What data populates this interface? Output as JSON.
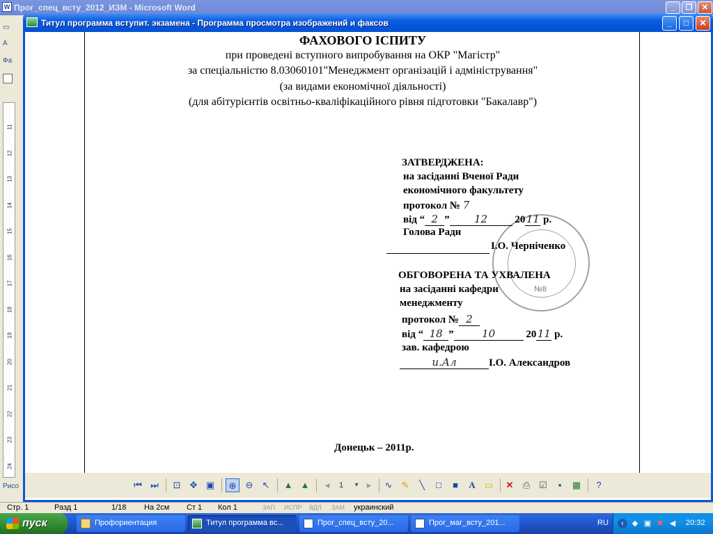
{
  "word_window": {
    "title": "Прог_спец_всту_2012_ИЗМ - Microsoft Word",
    "minimize_label": "_",
    "maximize_label": "❐",
    "close_label": "✕",
    "toolbar_fragment_1": "A",
    "toolbar_fragment_2": "Фа",
    "toolbar_fragment_3": "Рисо",
    "ruler_numbers": [
      "11",
      "12",
      "13",
      "14",
      "15",
      "16",
      "17",
      "18",
      "19",
      "20",
      "21",
      "22",
      "23",
      "24"
    ]
  },
  "viewer_window": {
    "title": "Титул программа вступит. экзамена - Программа просмотра изображений и факсов",
    "minimize_label": "_",
    "maximize_label": "□",
    "close_label": "✕"
  },
  "document": {
    "heading": "ФАХОВОГО ІСПИТУ",
    "line1": "при проведені вступного випробування на ОКР \"Магістр\"",
    "line2": "за спеціальністю 8.03060101\"Менеджмент організацій і адміністрування\"",
    "line3": "(за видами економічної діяльності)",
    "line4": "(для абітурієнтів освітньо-кваліфікаційного рівня підготовки \"Бакалавр\")",
    "approved": {
      "title": "ЗАТВЕРДЖЕНА:",
      "l1": "на засіданні Вченої Ради",
      "l2": "економічного факультету",
      "l3": "протокол №",
      "protocol_no": "7",
      "l4_prefix": "від “",
      "day": "2",
      "l4_mid": "”",
      "month": "12",
      "l4_year": "20",
      "year": "11",
      "l4_suffix": " р.",
      "l5": "Голова Ради",
      "signer": "І.О. Черніченко"
    },
    "discussed": {
      "title": "ОБГОВОРЕНА ТА УХВАЛЕНА",
      "l1": "на засіданні кафедри",
      "l2": "менеджменту",
      "l3": "протокол №",
      "protocol_no": "2",
      "l4_prefix": "від “",
      "day": "18",
      "l4_mid": "”",
      "month": "10",
      "l4_year": "20",
      "year": "11",
      "l4_suffix": " р.",
      "l5": "зав. кафедрою",
      "signature": "и.Ал",
      "signer": "І.О. Александров"
    },
    "stamp_text": "№8",
    "footer": "Донецьк – 2011р."
  },
  "viewer_toolbar": {
    "page_value": "1",
    "items": [
      "prev-image",
      "next-image",
      "best-fit",
      "actual-size",
      "slideshow",
      "zoom-in",
      "zoom-out",
      "select",
      "rotate-cw",
      "rotate-ccw",
      "page-prev",
      "page-next",
      "freehand",
      "highlighter",
      "line",
      "rectangle",
      "filled-rectangle",
      "text",
      "note",
      "delete",
      "print",
      "copy",
      "save",
      "open-in-editor",
      "help"
    ]
  },
  "statusbar": {
    "page": "Стр. 1",
    "section": "Разд 1",
    "pages": "1/18",
    "at": "На 2см",
    "line": "Ст 1",
    "col": "Кол 1",
    "rec": "ЗАП",
    "trk": "ИСПР",
    "ext": "ВДЛ",
    "ovr": "ЗАМ",
    "language": "украинский"
  },
  "taskbar": {
    "start_label": "пуск",
    "tasks": [
      {
        "label": "Профориентация"
      },
      {
        "label": "Титул программа вс..."
      },
      {
        "label": "Прог_спец_всту_20..."
      },
      {
        "label": "Прог_маг_всту_201..."
      }
    ],
    "language": "RU",
    "clock": "20:32"
  },
  "colors": {
    "viewer_titlebar": "#0a5ae0",
    "taskbar": "#245edb",
    "start_button": "#2f8a2f",
    "tray": "#1290e8"
  }
}
